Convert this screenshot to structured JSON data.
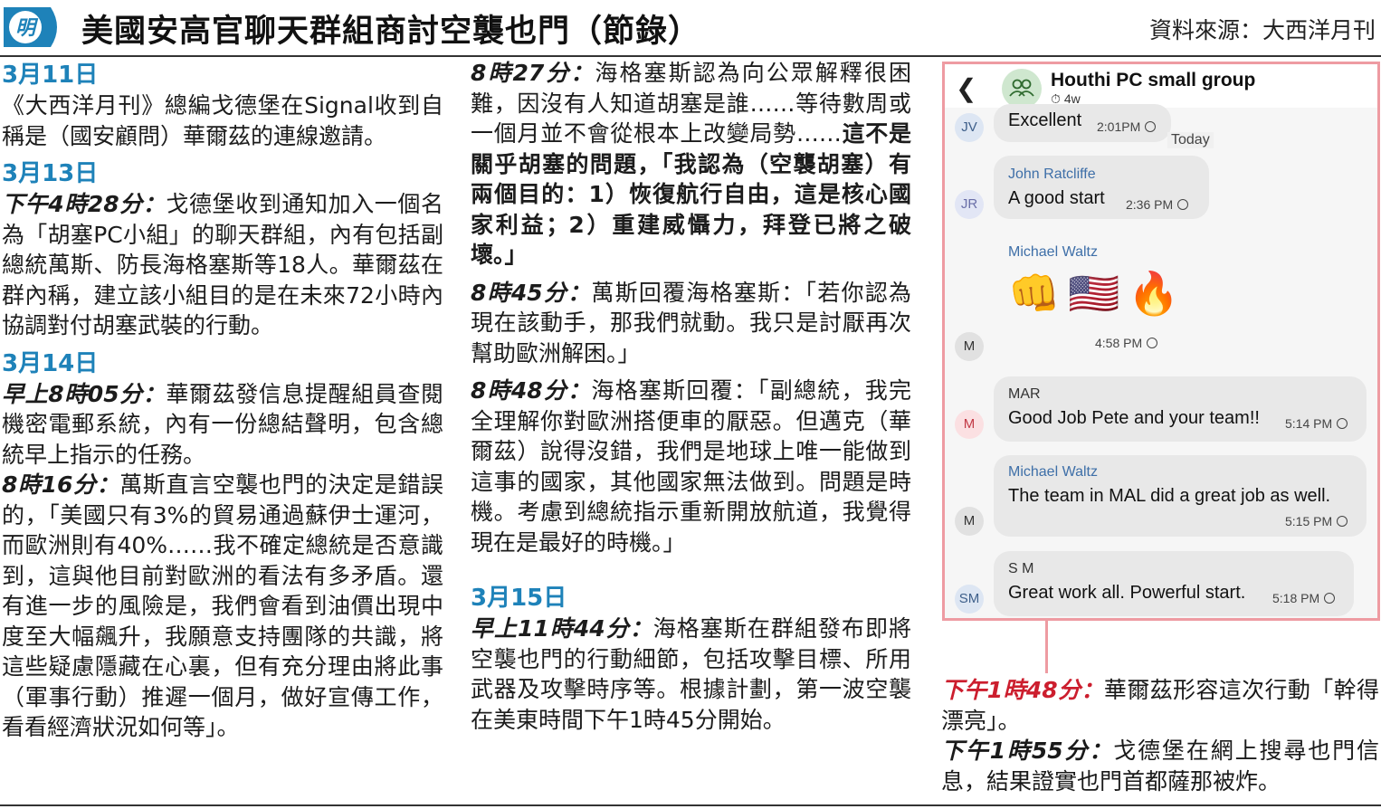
{
  "header": {
    "logo_text": "明",
    "title": "美國安高官聊天群組商討空襲也門（節錄）",
    "source": "資料來源：大西洋月刊"
  },
  "col1": {
    "d1": "3月11日",
    "p1": "《大西洋月刊》總編戈德堡在Signal收到自稱是（國安顧問）華爾茲的連線邀請。",
    "d2": "3月13日",
    "p2_time": "下午4時28分：",
    "p2_text": "戈德堡收到通知加入一個名為「胡塞PC小組」的聊天群組，內有包括副總統萬斯、防長海格塞斯等18人。華爾茲在群內稱，建立該小組目的是在未來72小時內協調對付胡塞武裝的行動。",
    "d3": "3月14日",
    "p3_time": "早上8時05分：",
    "p3_text": "華爾茲發信息提醒組員查閱機密電郵系統，內有一份總結聲明，包含總統早上指示的任務。",
    "p4_time": "8時16分：",
    "p4_text": "萬斯直言空襲也門的決定是錯誤的，「美國只有3%的貿易通過蘇伊士運河，而歐洲則有40%……我不確定總統是否意識到，這與他目前對歐洲的看法有多矛盾。還有進一步的風險是，我們會看到油價出現中度至大幅飆升，我願意支持團隊的共識，將這些疑慮隱藏在心裏，但有充分理由將此事（軍事行動）推遲一個月，做好宣傳工作，看看經濟狀況如何等」。"
  },
  "col2": {
    "p1_time": "8時27分：",
    "p1_text": "海格塞斯認為向公眾解釋很困難，因沒有人知道胡塞是誰……等待數周或一個月並不會從根本上改變局勢……",
    "p1_bold": "這不是關乎胡塞的問題，「我認為（空襲胡塞）有兩個目的：1）恢復航行自由，這是核心國家利益；2）重建威懾力，拜登已將之破壞。」",
    "p2_time": "8時45分：",
    "p2_text": "萬斯回覆海格塞斯：「若你認為現在該動手，那我們就動。我只是討厭再次幫助歐洲解困。」",
    "p3_time": "8時48分：",
    "p3_text": "海格塞斯回覆：「副總統，我完全理解你對歐洲搭便車的厭惡。但邁克（華爾茲）說得沒錯，我們是地球上唯一能做到這事的國家，其他國家無法做到。問題是時機。考慮到總統指示重新開放航道，我覺得現在是最好的時機。」",
    "d4": "3月15日",
    "p4_time": "早上11時44分：",
    "p4_text": "海格塞斯在群組發布即將空襲也門的行動細節，包括攻擊目標、所用武器及攻擊時序等。根據計劃，第一波空襲在美東時間下午1時45分開始。"
  },
  "chat": {
    "back_icon": "chevron-left-icon",
    "group_name": "Houthi PC small group",
    "group_meta": "4w",
    "today_label": "Today",
    "messages": [
      {
        "avatar": "JV",
        "sender": "",
        "text": "Excellent",
        "time": "2:01PM"
      },
      {
        "avatar": "JR",
        "sender": "John Ratcliffe",
        "text": "A good start",
        "time": "2:36 PM"
      },
      {
        "avatar": "M",
        "sender": "Michael Waltz",
        "text": "",
        "time": "4:58 PM"
      },
      {
        "avatar": "M",
        "sender": "MAR",
        "text": "Good Job Pete and your team!!",
        "time": "5:14 PM"
      },
      {
        "avatar": "M",
        "sender": "Michael Waltz",
        "text": "The team in MAL did a great job  as well.",
        "time": "5:15 PM"
      },
      {
        "avatar": "SM",
        "sender": "S M",
        "text": "Great work all. Powerful start.",
        "time": "5:18 PM"
      }
    ],
    "emojis": [
      "👊",
      "🇺🇸",
      "🔥"
    ],
    "colors": {
      "border": "#ee9ba2",
      "sender": "#3e6fa8",
      "bubble": "#e8e8e8"
    }
  },
  "col3": {
    "p1_time": "下午1時48分：",
    "p1_text": "華爾茲形容這次行動「幹得漂亮」。",
    "p2_time": "下午1時55分：",
    "p2_text": "戈德堡在網上搜尋也門信息，結果證實也門首都薩那被炸。"
  },
  "colors": {
    "date": "#1e82b9",
    "time_red": "#cc1e2e",
    "logo": "#1e82b9"
  }
}
